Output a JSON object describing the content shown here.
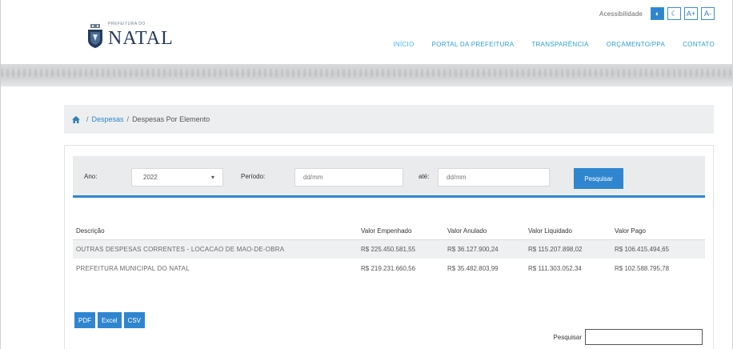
{
  "accessibility": {
    "label": "Acessibilidade",
    "buttons": [
      "◐",
      "☾",
      "A+",
      "A-"
    ]
  },
  "header": {
    "logo_small": "PREFEITURA DO",
    "logo_big": "NATAL"
  },
  "nav": [
    "INÍCIO",
    "PORTAL DA PREFEITURA",
    "TRANSPARÊNCIA",
    "ORÇAMENTO/PPA",
    "CONTATO"
  ],
  "breadcrumb": {
    "home_icon": "home-icon",
    "sep": "/",
    "link": "Despesas",
    "current": "Despesas Por Elemento"
  },
  "filters": {
    "year_label": "Ano:",
    "year_value": "2022",
    "period_label": "Período:",
    "period_start_placeholder": "dd/mm",
    "to_label": "até:",
    "period_end_placeholder": "dd/mm",
    "search_button": "Pesquisar"
  },
  "table": {
    "headers": [
      "Descrição",
      "Valor Empenhado",
      "Valor Anulado",
      "Valor Liquidado",
      "Valor Pago"
    ],
    "rows": [
      [
        "OUTRAS DESPESAS CORRENTES - LOCACAO DE MAO-DE-OBRA",
        "R$ 225.450.581,55",
        "R$ 36.127.900,24",
        "R$ 115.207.898,02",
        "R$ 106.415.494,65"
      ],
      [
        "PREFEITURA MUNICIPAL DO NATAL",
        "R$ 219.231.660,56",
        "R$ 35.482.803,99",
        "R$ 111.303.052,34",
        "R$ 102.588.795,78"
      ]
    ]
  },
  "exports": [
    "PDF",
    "Excel",
    "CSV"
  ],
  "search": {
    "label": "Pesquisar"
  },
  "colors": {
    "accent": "#2f86cf",
    "nav": "#2aa0d8",
    "brand": "#243b5c"
  }
}
